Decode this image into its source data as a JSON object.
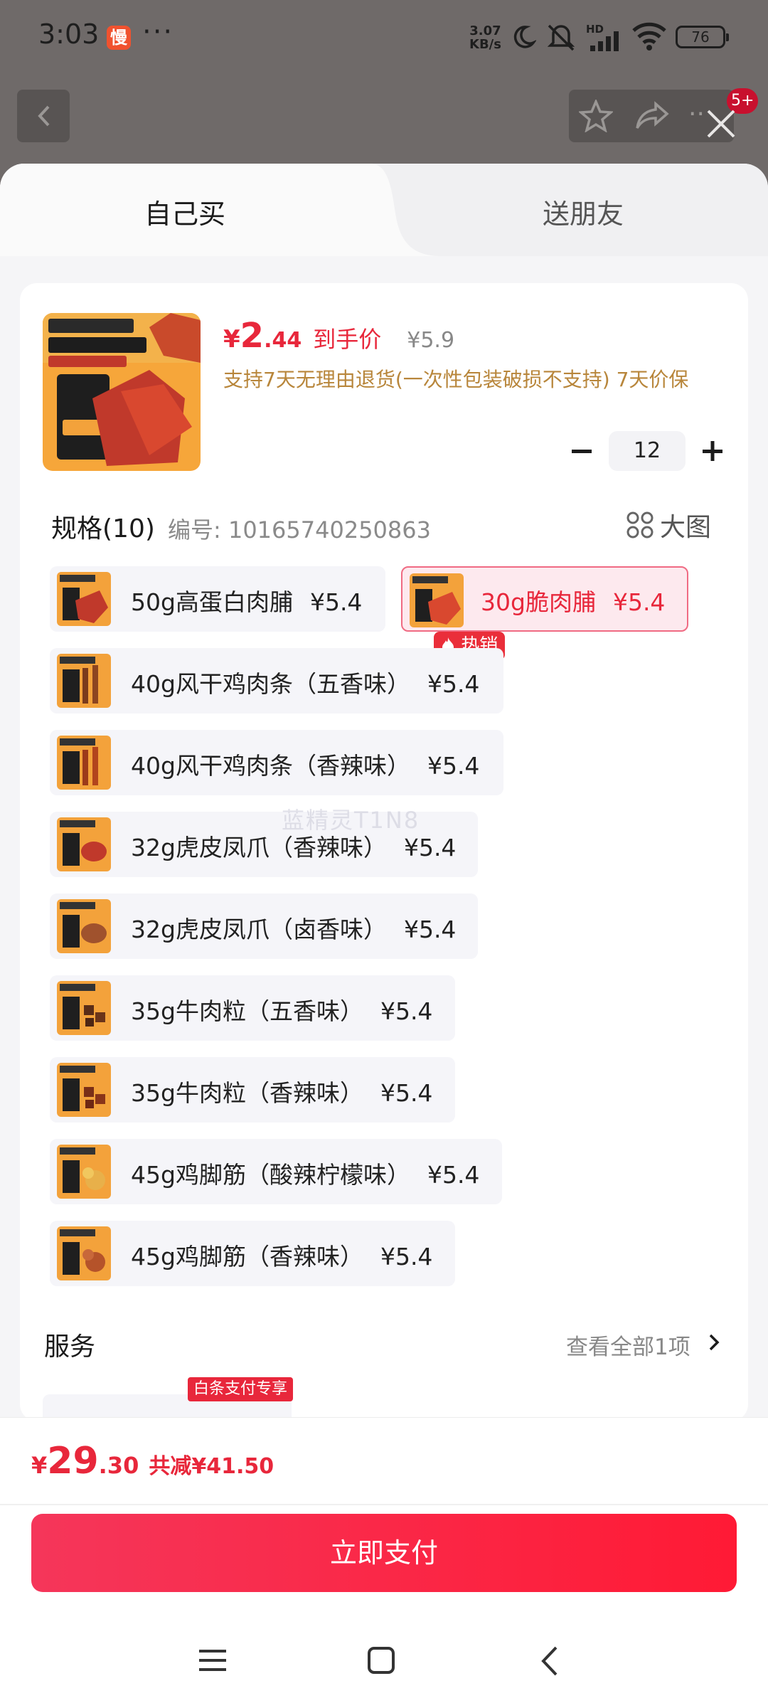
{
  "status_bar": {
    "time": "3:03",
    "app_icon_char": "慢",
    "more": "···",
    "speed_value": "3.07",
    "speed_unit": "KB/s",
    "hd": "HD",
    "battery": "76"
  },
  "top_nav": {
    "cart_badge": "5+"
  },
  "tabs": {
    "self": "自己买",
    "friend": "送朋友"
  },
  "product": {
    "price_currency": "¥",
    "price_int": "2",
    "price_dec": ".44",
    "price_tag": "到手价",
    "price_original": "¥5.9",
    "policy": "支持7天无理由退货(一次性包装破损不支持) 7天价保",
    "quantity": "12"
  },
  "specs": {
    "title": "规格(10)",
    "code": "编号: 10165740250863",
    "big_image_label": "大图",
    "hot_badge": "热销",
    "options": [
      {
        "name": "50g高蛋白肉脯",
        "price": "¥5.4",
        "selected": false
      },
      {
        "name": "30g脆肉脯",
        "price": "¥5.4",
        "selected": true
      },
      {
        "name": "40g风干鸡肉条（五香味）",
        "price": "¥5.4",
        "selected": false
      },
      {
        "name": "40g风干鸡肉条（香辣味）",
        "price": "¥5.4",
        "selected": false
      },
      {
        "name": "32g虎皮凤爪（香辣味）",
        "price": "¥5.4",
        "selected": false
      },
      {
        "name": "32g虎皮凤爪（卤香味）",
        "price": "¥5.4",
        "selected": false
      },
      {
        "name": "35g牛肉粒（五香味）",
        "price": "¥5.4",
        "selected": false
      },
      {
        "name": "35g牛肉粒（香辣味）",
        "price": "¥5.4",
        "selected": false
      },
      {
        "name": "45g鸡脚筋（酸辣柠檬味）",
        "price": "¥5.4",
        "selected": false
      },
      {
        "name": "45g鸡脚筋（香辣味）",
        "price": "¥5.4",
        "selected": false
      }
    ]
  },
  "watermark": "蓝精灵T1N8",
  "service": {
    "title": "服务",
    "view_all": "查看全部1项",
    "badge": "白条支付专享"
  },
  "footer": {
    "total_currency": "¥",
    "total_int": "29",
    "total_dec": ".30",
    "total_save": "共减¥41.50",
    "pay_button": "立即支付"
  },
  "colors": {
    "accent": "#e8273b",
    "policy": "#b8863b"
  }
}
